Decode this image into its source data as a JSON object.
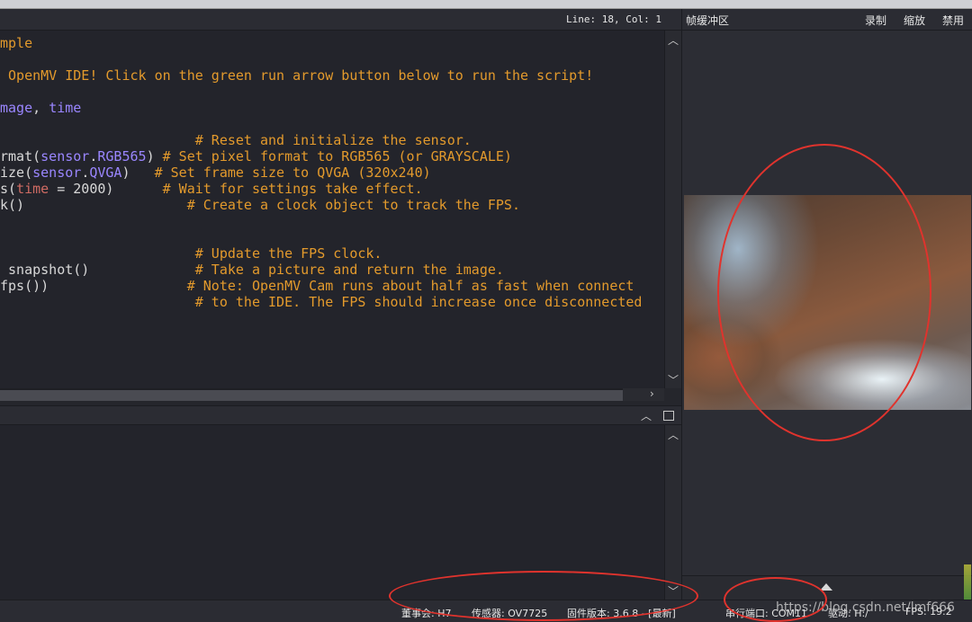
{
  "editor": {
    "line_col": "Line: 18, Col: 1",
    "lines": [
      {
        "parts": [
          {
            "t": "mple",
            "c": "cmt"
          }
        ]
      },
      {
        "parts": [
          {
            "t": " OpenMV IDE! Click on the green run arrow button below to run the script!",
            "c": "cmt"
          }
        ]
      },
      {
        "parts": [
          {
            "t": "mage",
            "c": "mod"
          },
          {
            "t": ", ",
            "c": "fn"
          },
          {
            "t": "time",
            "c": "mod"
          }
        ]
      },
      {
        "parts": [
          {
            "t": "                        ",
            "c": "fn"
          },
          {
            "t": "# Reset and initialize the sensor.",
            "c": "cmt"
          }
        ]
      },
      {
        "parts": [
          {
            "t": "rmat",
            "c": "fn"
          },
          {
            "t": "(",
            "c": "fn"
          },
          {
            "t": "sensor",
            "c": "mod"
          },
          {
            "t": ".",
            "c": "fn"
          },
          {
            "t": "RGB565",
            "c": "mod"
          },
          {
            "t": ") ",
            "c": "fn"
          },
          {
            "t": "# Set pixel format to RGB565 (or GRAYSCALE)",
            "c": "cmt"
          }
        ]
      },
      {
        "parts": [
          {
            "t": "ize",
            "c": "fn"
          },
          {
            "t": "(",
            "c": "fn"
          },
          {
            "t": "sensor",
            "c": "mod"
          },
          {
            "t": ".",
            "c": "fn"
          },
          {
            "t": "QVGA",
            "c": "mod"
          },
          {
            "t": ")   ",
            "c": "fn"
          },
          {
            "t": "# Set frame size to QVGA (320x240)",
            "c": "cmt"
          }
        ]
      },
      {
        "parts": [
          {
            "t": "s",
            "c": "fn"
          },
          {
            "t": "(",
            "c": "fn"
          },
          {
            "t": "time",
            "c": "kw"
          },
          {
            "t": " = 2000)      ",
            "c": "fn"
          },
          {
            "t": "# Wait for settings take effect.",
            "c": "cmt"
          }
        ]
      },
      {
        "parts": [
          {
            "t": "k",
            "c": "fn"
          },
          {
            "t": "()                    ",
            "c": "fn"
          },
          {
            "t": "# Create a clock object to track the FPS.",
            "c": "cmt"
          }
        ]
      },
      {
        "parts": [
          {
            "t": "",
            "c": "fn"
          }
        ]
      },
      {
        "parts": [
          {
            "t": "",
            "c": "fn"
          }
        ]
      },
      {
        "parts": [
          {
            "t": "                        ",
            "c": "fn"
          },
          {
            "t": "# Update the FPS clock.",
            "c": "cmt"
          }
        ]
      },
      {
        "parts": [
          {
            "t": " snapshot",
            "c": "fn"
          },
          {
            "t": "()             ",
            "c": "fn"
          },
          {
            "t": "# Take a picture and return the image.",
            "c": "cmt"
          }
        ]
      },
      {
        "parts": [
          {
            "t": "fps",
            "c": "fn"
          },
          {
            "t": "())                 ",
            "c": "fn"
          },
          {
            "t": "# Note: OpenMV Cam runs about half as fast when connect",
            "c": "cmt"
          }
        ]
      },
      {
        "parts": [
          {
            "t": "                        ",
            "c": "fn"
          },
          {
            "t": "# to the IDE. The FPS should increase once disconnected",
            "c": "cmt"
          }
        ]
      }
    ]
  },
  "frame_buffer": {
    "title": "帧缓冲区",
    "record": "录制",
    "zoom": "缩放",
    "disable": "禁用"
  },
  "status_bar": {
    "board": "董事会: H7",
    "sensor": "传感器: OV7725",
    "firmware": "固件版本: 3.6.8 - [最新]",
    "serial": "串行端口: COM11",
    "drive": "驱动: H:/",
    "fps": "FPS:  19.2"
  },
  "watermark": "https://blog.csdn.net/lmf666",
  "colors": {
    "annotation": "#e0332d",
    "comment": "#e39a2c",
    "module": "#9a86ff",
    "keyword": "#cf6b63"
  },
  "icons": [
    "scroll-up-icon",
    "scroll-down-icon",
    "scroll-right-icon",
    "chevron-up-icon",
    "panel-toggle-icon",
    "triangle-up-icon"
  ]
}
